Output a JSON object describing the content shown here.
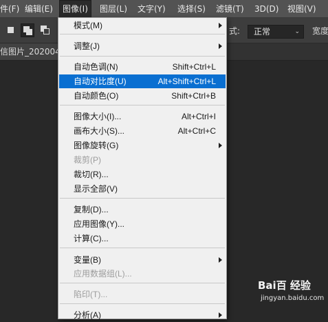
{
  "menubar": {
    "items": [
      {
        "label": "件(F)"
      },
      {
        "label": "编辑(E)"
      },
      {
        "label": "图像(I)"
      },
      {
        "label": "图层(L)"
      },
      {
        "label": "文字(Y)"
      },
      {
        "label": "选择(S)"
      },
      {
        "label": "滤镜(T)"
      },
      {
        "label": "3D(D)"
      },
      {
        "label": "视图(V)"
      }
    ]
  },
  "optbar": {
    "style_label": "式:",
    "style_value": "正常",
    "width_label": "宽度"
  },
  "document": {
    "tab_title": "信图片_202004"
  },
  "image_menu": {
    "items": [
      {
        "label": "模式(M)",
        "shortcut": "",
        "submenu": true,
        "disabled": false
      },
      {
        "label": "调整(J)",
        "shortcut": "",
        "submenu": true,
        "disabled": false
      },
      {
        "label": "自动色调(N)",
        "shortcut": "Shift+Ctrl+L",
        "submenu": false,
        "disabled": false
      },
      {
        "label": "自动对比度(U)",
        "shortcut": "Alt+Shift+Ctrl+L",
        "submenu": false,
        "disabled": false,
        "highlighted": true
      },
      {
        "label": "自动颜色(O)",
        "shortcut": "Shift+Ctrl+B",
        "submenu": false,
        "disabled": false
      },
      {
        "label": "图像大小(I)...",
        "shortcut": "Alt+Ctrl+I",
        "submenu": false,
        "disabled": false
      },
      {
        "label": "画布大小(S)...",
        "shortcut": "Alt+Ctrl+C",
        "submenu": false,
        "disabled": false
      },
      {
        "label": "图像旋转(G)",
        "shortcut": "",
        "submenu": true,
        "disabled": false
      },
      {
        "label": "裁剪(P)",
        "shortcut": "",
        "submenu": false,
        "disabled": true
      },
      {
        "label": "裁切(R)...",
        "shortcut": "",
        "submenu": false,
        "disabled": false
      },
      {
        "label": "显示全部(V)",
        "shortcut": "",
        "submenu": false,
        "disabled": false
      },
      {
        "label": "复制(D)...",
        "shortcut": "",
        "submenu": false,
        "disabled": false
      },
      {
        "label": "应用图像(Y)...",
        "shortcut": "",
        "submenu": false,
        "disabled": false
      },
      {
        "label": "计算(C)...",
        "shortcut": "",
        "submenu": false,
        "disabled": false
      },
      {
        "label": "变量(B)",
        "shortcut": "",
        "submenu": true,
        "disabled": false
      },
      {
        "label": "应用数据组(L)...",
        "shortcut": "",
        "submenu": false,
        "disabled": true
      },
      {
        "label": "陷印(T)...",
        "shortcut": "",
        "submenu": false,
        "disabled": true
      },
      {
        "label": "分析(A)",
        "shortcut": "",
        "submenu": true,
        "disabled": false
      }
    ]
  },
  "watermark": {
    "logo_text": "Bai百 经验",
    "url": "jingyan.baidu.com"
  },
  "colors": {
    "highlight": "#0a6fd1",
    "menu_bg": "#f0f0f0",
    "menubar_bg": "#535353"
  }
}
